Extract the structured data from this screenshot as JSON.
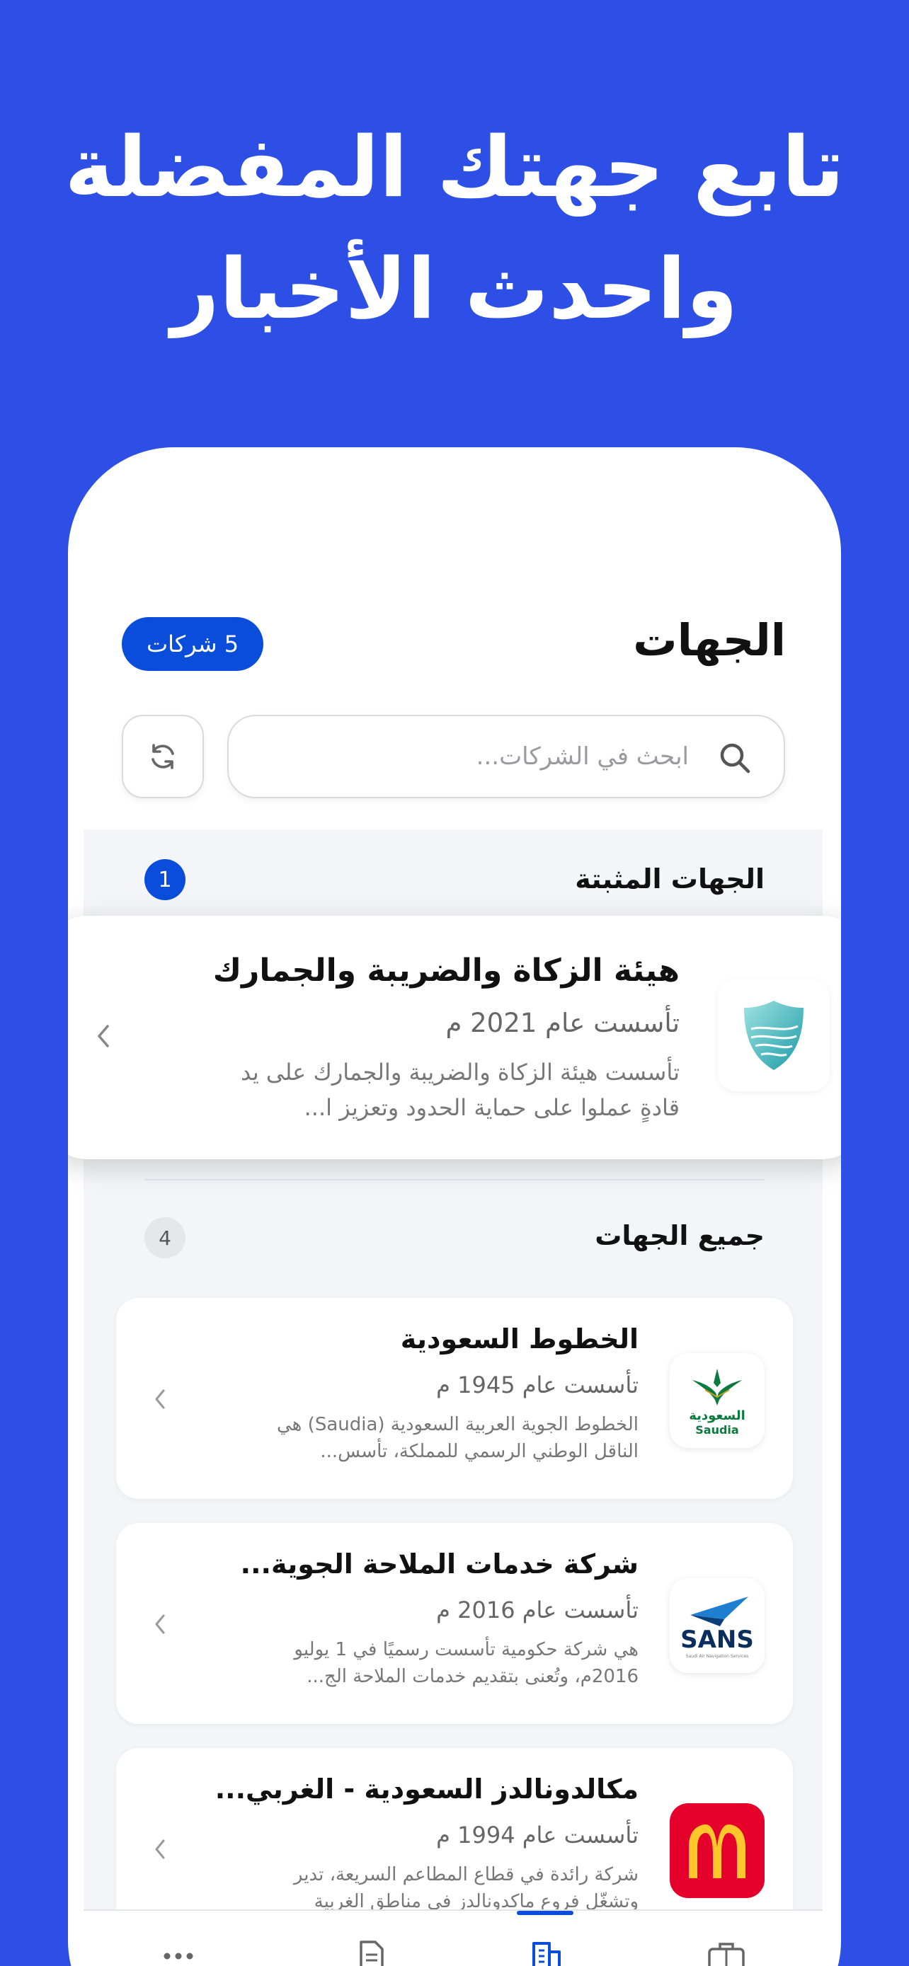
{
  "headline": {
    "line1": "تابع جهتك المفضلة",
    "line2": "واحدث الأخبار"
  },
  "header": {
    "title": "الجهات",
    "count_badge": "5 شركات"
  },
  "search": {
    "placeholder": "ابحث في الشركات..."
  },
  "pinned": {
    "label": "الجهات المثبتة",
    "count": "1",
    "items": [
      {
        "name": "هيئة الزكاة والضريبة والجمارك",
        "founded": "تأسست عام 2021 م",
        "description": "تأسست هيئة الزكاة والضريبة والجمارك على يد قادةٍ عملوا على حماية الحدود وتعزيز ا...",
        "logo": "zatca-shield-logo"
      }
    ]
  },
  "all": {
    "label": "جميع الجهات",
    "count": "4",
    "items": [
      {
        "name": "الخطوط السعودية",
        "founded": "تأسست عام 1945 م",
        "description": "الخطوط الجوية العربية السعودية (Saudia) هي الناقل الوطني الرسمي للمملكة، تأسس...",
        "logo_text_ar": "السعودية",
        "logo_text_en": "Saudia"
      },
      {
        "name": "شركة خدمات الملاحة الجوية...",
        "founded": "تأسست عام 2016 م",
        "description": "هي شركة حكومية تأسست رسميًا في 1 يوليو 2016م، وتُعنى بتقديم خدمات الملاحة الج...",
        "logo_text": "SANS",
        "logo_subtext": "Saudi Air Navigation Services"
      },
      {
        "name": "مكالدونالدز السعودية - الغربي...",
        "founded": "تأسست عام 1994 م",
        "description": "شركة رائدة في قطاع المطاعم السريعة، تدير وتشغّل فروع ماكدونالدز في مناطق الغربية",
        "logo": "mcdonalds-arches-logo"
      }
    ]
  },
  "colors": {
    "background": "#2D4FE6",
    "accent": "#0A4DDB"
  },
  "tabbar": {
    "active": "companies-tab",
    "tabs": [
      "more-icon",
      "document-icon",
      "building-icon",
      "briefcase-icon"
    ]
  }
}
